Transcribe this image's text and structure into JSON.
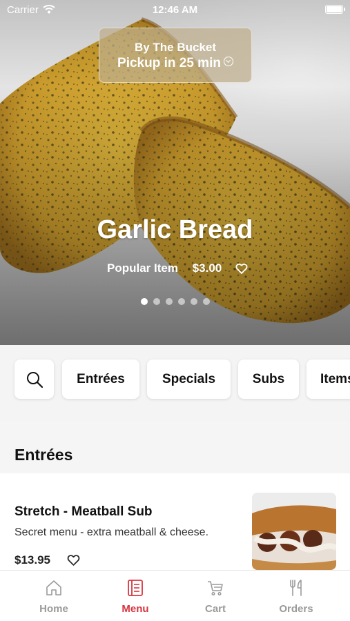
{
  "status_bar": {
    "carrier": "Carrier",
    "time": "12:46 AM"
  },
  "store": {
    "name": "By The Bucket",
    "pickup": "Pickup in 25 min"
  },
  "featured": {
    "title": "Garlic Bread",
    "badge": "Popular Item",
    "price": "$3.00",
    "slides_total": 6,
    "active_slide": 1
  },
  "categories": {
    "search_icon": "search-icon",
    "items": [
      "Entrées",
      "Specials",
      "Subs",
      "Items"
    ]
  },
  "section": {
    "title": "Entrées"
  },
  "menu_item": {
    "name": "Stretch - Meatball Sub",
    "description": "Secret menu - extra meatball & cheese.",
    "price": "$13.95"
  },
  "tabs": [
    {
      "label": "Home",
      "icon": "home-icon"
    },
    {
      "label": "Menu",
      "icon": "menu-book-icon",
      "active": true
    },
    {
      "label": "Cart",
      "icon": "cart-icon"
    },
    {
      "label": "Orders",
      "icon": "utensils-icon"
    }
  ],
  "colors": {
    "accent": "#d8343f",
    "tab_inactive": "#9a9a9a"
  }
}
